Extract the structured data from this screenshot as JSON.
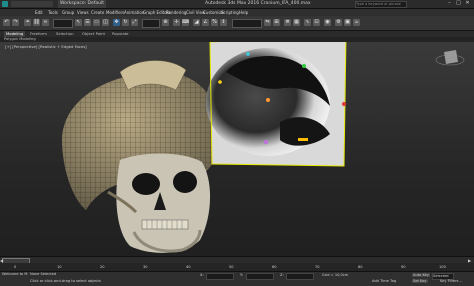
{
  "titlebar": {
    "workspace_label": "Workspace: Default",
    "search_placeholder": "Type a keyword or phrase",
    "title": "Autodesk 3ds Max 2016    Cranium_IFA_400.max",
    "window_buttons": [
      "–",
      "□",
      "✕"
    ]
  },
  "menubar": {
    "items": [
      "Edit",
      "Tools",
      "Group",
      "Views",
      "Create",
      "Modifiers",
      "Animation",
      "Graph Editors",
      "Rendering",
      "Civil View",
      "Customize",
      "Scripting",
      "Help"
    ]
  },
  "toolbar": {
    "icons": [
      "undo-icon",
      "redo-icon",
      "link-icon",
      "unlink-icon",
      "bind-icon",
      "filter-dropdown",
      "select-icon",
      "select-by-name-icon",
      "rect-select-icon",
      "window-crossing-icon",
      "move-icon",
      "rotate-icon",
      "scale-icon",
      "reference-coord-dropdown",
      "pivot-icon",
      "select-manipulate-icon",
      "keyboard-shortcut-icon",
      "snap-icon",
      "angle-snap-icon",
      "percent-snap-icon",
      "spinner-snap-icon",
      "named-selection-dropdown",
      "mirror-icon",
      "align-icon",
      "layer-icon",
      "graphite-icon",
      "curve-editor-icon",
      "schematic-icon",
      "material-editor-icon",
      "render-setup-icon",
      "rendered-frame-icon",
      "render-icon"
    ]
  },
  "ribbon": {
    "tabs": [
      "Modeling",
      "Freeform",
      "Selection",
      "Object Paint",
      "Populate"
    ],
    "active_tab": "Modeling",
    "sub_label": "Polygon Modeling"
  },
  "viewport": {
    "label": "[+] [Perspective] [Realistic + Edged Faces]",
    "colors": {
      "frame": "#e8e800",
      "mesh": "#bfb08a",
      "bg_top": "#3a3a3a"
    }
  },
  "timeline": {
    "frame_readout": "0 / 100",
    "ticks": [
      "0",
      "10",
      "20",
      "30",
      "40",
      "50",
      "60",
      "70",
      "80",
      "90",
      "100"
    ]
  },
  "statusbar": {
    "selection": "None Selected",
    "prompt": "Click or click-and-drag to select objects",
    "welcome": "Welcome to M",
    "x_label": "X:",
    "y_label": "Y:",
    "z_label": "Z:",
    "grid": "Grid = 10,0cm",
    "auto_key": "Auto Key",
    "set_key": "Set Key",
    "selected_dropdown": "Selected",
    "add_time_tag": "Add Time Tag",
    "key_filters": "Key Filters..."
  }
}
